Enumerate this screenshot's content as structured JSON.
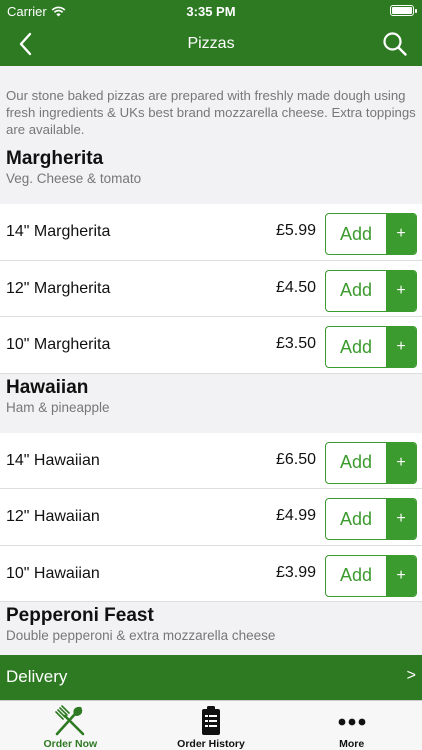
{
  "status_bar": {
    "carrier": "Carrier",
    "time": "3:35 PM"
  },
  "nav": {
    "title": "Pizzas",
    "back_icon": "chevron-left-icon",
    "search_icon": "search-icon"
  },
  "intro_text": "Our stone baked pizzas are prepared with freshly made dough using fresh ingredients & UKs best brand mozzarella cheese. Extra toppings are available.",
  "add_label": "Add",
  "plus_label": "+",
  "categories": [
    {
      "name": "Margherita",
      "description": "Veg. Cheese & tomato",
      "items": [
        {
          "name": "14\" Margherita",
          "price": "£5.99"
        },
        {
          "name": "12\" Margherita",
          "price": "£4.50"
        },
        {
          "name": "10\" Margherita",
          "price": "£3.50"
        }
      ]
    },
    {
      "name": "Hawaiian",
      "description": "Ham & pineapple",
      "items": [
        {
          "name": "14\" Hawaiian",
          "price": "£6.50"
        },
        {
          "name": "12\" Hawaiian",
          "price": "£4.99"
        },
        {
          "name": "10\" Hawaiian",
          "price": "£3.99"
        }
      ]
    },
    {
      "name": "Pepperoni Feast",
      "description": "Double pepperoni & extra mozzarella cheese",
      "items": []
    }
  ],
  "delivery_bar": {
    "label": "Delivery",
    "chevron": ">"
  },
  "tabs": [
    {
      "label": "Order Now",
      "icon": "fork-knife-icon",
      "active": true
    },
    {
      "label": "Order History",
      "icon": "clipboard-icon",
      "active": false
    },
    {
      "label": "More",
      "icon": "more-dots-icon",
      "active": false
    }
  ],
  "colors": {
    "brand_green": "#2d7a22",
    "accent_green": "#3c9b2e"
  }
}
